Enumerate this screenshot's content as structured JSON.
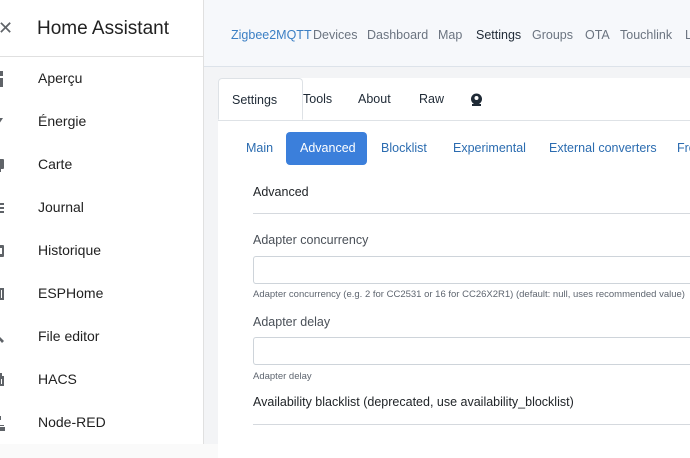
{
  "sidebar": {
    "title": "Home Assistant",
    "items": [
      {
        "label": "Aperçu",
        "icon": "overview-icon"
      },
      {
        "label": "Énergie",
        "icon": "energy-icon"
      },
      {
        "label": "Carte",
        "icon": "map-icon"
      },
      {
        "label": "Journal",
        "icon": "logbook-icon"
      },
      {
        "label": "Historique",
        "icon": "history-icon"
      },
      {
        "label": "ESPHome",
        "icon": "esphome-icon"
      },
      {
        "label": "File editor",
        "icon": "wrench-icon"
      },
      {
        "label": "HACS",
        "icon": "hacs-icon"
      },
      {
        "label": "Node-RED",
        "icon": "sitemap-icon"
      }
    ]
  },
  "topnav": {
    "brand": "Zigbee2MQTT",
    "links": [
      "Devices",
      "Dashboard",
      "Map",
      "Settings",
      "Groups",
      "OTA",
      "Touchlink",
      "L"
    ],
    "active": "Settings"
  },
  "tabs": {
    "items": [
      "Settings",
      "Tools",
      "About",
      "Raw"
    ],
    "extra_icon": "donate-icon",
    "active": "Settings"
  },
  "subtabs": {
    "items": [
      "Main",
      "Advanced",
      "Blocklist",
      "Experimental",
      "External converters",
      "Fro"
    ],
    "active": "Advanced"
  },
  "form": {
    "section_title": "Advanced",
    "fields": [
      {
        "label": "Adapter concurrency",
        "value": "",
        "help": "Adapter concurrency (e.g. 2 for CC2531 or 16 for CC26X2R1) (default: null, uses recommended value)"
      },
      {
        "label": "Adapter delay",
        "value": "",
        "help": "Adapter delay"
      }
    ],
    "next_section": "Availability blacklist (deprecated, use availability_blocklist)"
  },
  "colors": {
    "accent": "#3b7fdb",
    "link": "#2b6cb0",
    "brand": "#3b7fc4"
  }
}
